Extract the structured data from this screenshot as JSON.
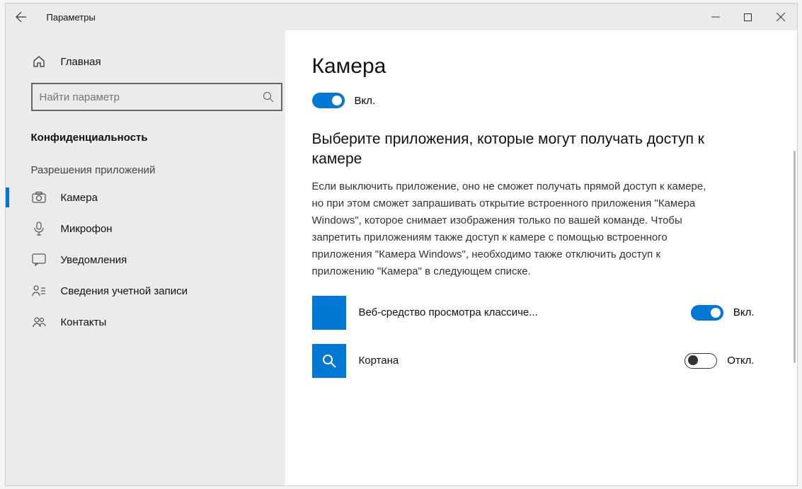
{
  "titlebar": {
    "title": "Параметры"
  },
  "sidebar": {
    "home": "Главная",
    "search_placeholder": "Найти параметр",
    "category": "Конфиденциальность",
    "section": "Разрешения приложений",
    "items": [
      {
        "label": "Камера"
      },
      {
        "label": "Микрофон"
      },
      {
        "label": "Уведомления"
      },
      {
        "label": "Сведения учетной записи"
      },
      {
        "label": "Контакты"
      }
    ]
  },
  "content": {
    "title": "Камера",
    "master_toggle": {
      "state": "on",
      "label": "Вкл."
    },
    "section_title": "Выберите приложения, которые могут получать доступ к камере",
    "description": "Если выключить приложение, оно не сможет получать прямой доступ к камере, но при этом сможет запрашивать открытие встроенного приложения \"Камера Windows\", которое снимает изображения только по вашей команде. Чтобы запретить приложениям также доступ к камере с помощью встроенного приложения \"Камера Windows\", необходимо также отключить доступ к приложению \"Камера\" в следующем списке.",
    "apps": [
      {
        "name": "Веб-средство просмотра классиче...",
        "state": "on",
        "state_label": "Вкл."
      },
      {
        "name": "Кортана",
        "state": "off",
        "state_label": "Откл."
      }
    ]
  }
}
